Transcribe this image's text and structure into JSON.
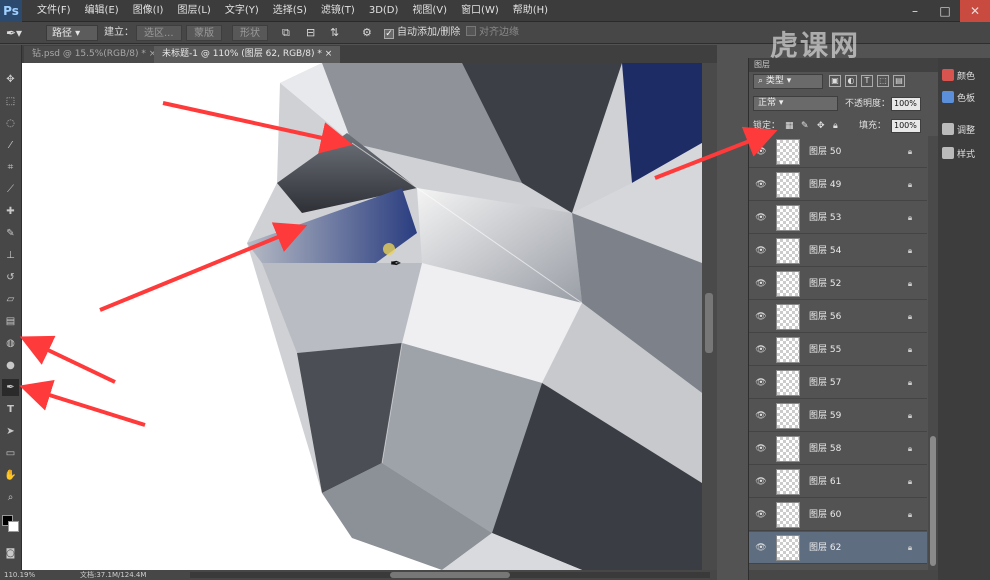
{
  "app": {
    "logo": "Ps"
  },
  "menu": [
    "文件(F)",
    "编辑(E)",
    "图像(I)",
    "图层(L)",
    "文字(Y)",
    "选择(S)",
    "滤镜(T)",
    "3D(D)",
    "视图(V)",
    "窗口(W)",
    "帮助(H)"
  ],
  "options": {
    "mode": "路径",
    "build_label": "建立：",
    "selection_btn": "选区...",
    "mask_btn": "蒙版",
    "shape_btn": "形状",
    "auto_add_delete": "自动添加/删除",
    "align_edges": "对齐边缘"
  },
  "tabs": [
    {
      "label": "钻.psd @ 15.5%(RGB/8) *",
      "active": false
    },
    {
      "label": "未标题-1 @ 110% (图层 62, RGB/8) *",
      "active": true
    }
  ],
  "status": {
    "zoom": "110.19%",
    "doc": "文档:37.1M/124.4M"
  },
  "layers_panel": {
    "header": "图层",
    "filter_label": "类型",
    "blend_mode": "正常",
    "opacity_label": "不透明度：",
    "opacity_value": "100%",
    "lock_label": "锁定：",
    "fill_label": "填充：",
    "fill_value": "100%",
    "layers": [
      {
        "name": "图层 50",
        "selected": false
      },
      {
        "name": "图层 49",
        "selected": false
      },
      {
        "name": "图层 53",
        "selected": false
      },
      {
        "name": "图层 54",
        "selected": false
      },
      {
        "name": "图层 52",
        "selected": false
      },
      {
        "name": "图层 56",
        "selected": false
      },
      {
        "name": "图层 55",
        "selected": false
      },
      {
        "name": "图层 57",
        "selected": false
      },
      {
        "name": "图层 59",
        "selected": false
      },
      {
        "name": "图层 58",
        "selected": false
      },
      {
        "name": "图层 61",
        "selected": false
      },
      {
        "name": "图层 60",
        "selected": false
      },
      {
        "name": "图层 62",
        "selected": true
      }
    ]
  },
  "dock": [
    {
      "label": "颜色",
      "color": "#d9534f"
    },
    {
      "label": "色板",
      "color": "#5b8fd9"
    },
    {
      "label": "调整",
      "color": "#bbbbbb"
    },
    {
      "label": "样式",
      "color": "#bbbbbb"
    }
  ],
  "watermark": "虎课网",
  "colors": {
    "arrow": "#ff3a3a",
    "selected_layer": "#5f6d80"
  }
}
